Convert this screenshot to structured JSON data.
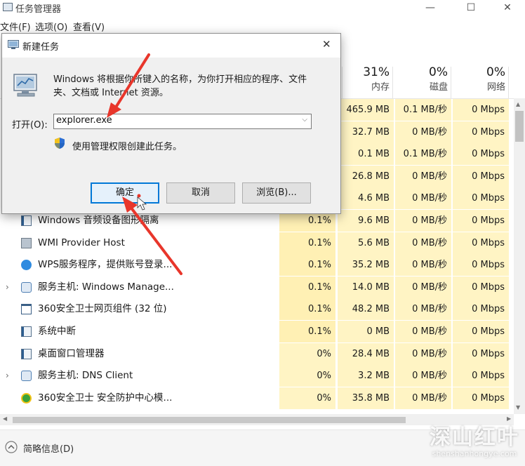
{
  "window": {
    "title": "任务管理器",
    "minimize": "—",
    "maximize": "☐",
    "close": "✕"
  },
  "menu": [
    "文件(F)",
    "选项(O)",
    "查看(V)"
  ],
  "columns": [
    {
      "pct": "31%",
      "name": "内存"
    },
    {
      "pct": "0%",
      "name": "磁盘"
    },
    {
      "pct": "0%",
      "name": "网络"
    }
  ],
  "rows": [
    {
      "name": "",
      "cpu": "",
      "mem": "465.9 MB",
      "disk": "0.1 MB/秒",
      "net": "0 Mbps",
      "expand": false,
      "icon": "none"
    },
    {
      "name": "",
      "cpu": "",
      "mem": "32.7 MB",
      "disk": "0 MB/秒",
      "net": "0 Mbps",
      "expand": false,
      "icon": "none"
    },
    {
      "name": "",
      "cpu": "",
      "mem": "0.1 MB",
      "disk": "0.1 MB/秒",
      "net": "0 Mbps",
      "expand": false,
      "icon": "none"
    },
    {
      "name": "",
      "cpu": "",
      "mem": "26.8 MB",
      "disk": "0 MB/秒",
      "net": "0 Mbps",
      "expand": false,
      "icon": "none"
    },
    {
      "name": "",
      "cpu": "",
      "mem": "4.6 MB",
      "disk": "0 MB/秒",
      "net": "0 Mbps",
      "expand": false,
      "icon": "none"
    },
    {
      "name": "Windows 音频设备图形隔离",
      "cpu": "0.1%",
      "mem": "9.6 MB",
      "disk": "0 MB/秒",
      "net": "0 Mbps",
      "expand": false,
      "icon": "app-window-icon"
    },
    {
      "name": "WMI Provider Host",
      "cpu": "0.1%",
      "mem": "5.6 MB",
      "disk": "0 MB/秒",
      "net": "0 Mbps",
      "expand": false,
      "icon": "wmi-icon"
    },
    {
      "name": "WPS服务程序，提供账号登录...",
      "cpu": "0.1%",
      "mem": "35.2 MB",
      "disk": "0 MB/秒",
      "net": "0 Mbps",
      "expand": false,
      "icon": "wps-cloud-icon"
    },
    {
      "name": "服务主机: Windows Manage...",
      "cpu": "0.1%",
      "mem": "14.0 MB",
      "disk": "0 MB/秒",
      "net": "0 Mbps",
      "expand": true,
      "icon": "service-gear-icon"
    },
    {
      "name": "360安全卫士网页组件 (32 位)",
      "cpu": "0.1%",
      "mem": "48.2 MB",
      "disk": "0 MB/秒",
      "net": "0 Mbps",
      "expand": false,
      "icon": "browser-window-icon"
    },
    {
      "name": "系统中断",
      "cpu": "0.1%",
      "mem": "0 MB",
      "disk": "0 MB/秒",
      "net": "0 Mbps",
      "expand": false,
      "icon": "app-window-icon"
    },
    {
      "name": "桌面窗口管理器",
      "cpu": "0%",
      "mem": "28.4 MB",
      "disk": "0 MB/秒",
      "net": "0 Mbps",
      "expand": false,
      "icon": "app-window-icon"
    },
    {
      "name": "服务主机: DNS Client",
      "cpu": "0%",
      "mem": "3.2 MB",
      "disk": "0 MB/秒",
      "net": "0 Mbps",
      "expand": true,
      "icon": "service-gear-icon"
    },
    {
      "name": "360安全卫士 安全防护中心模...",
      "cpu": "0%",
      "mem": "35.8 MB",
      "disk": "0 MB/秒",
      "net": "0 Mbps",
      "expand": false,
      "icon": "shield-360-icon"
    }
  ],
  "footer": {
    "label": "简略信息(D)"
  },
  "dialog": {
    "title": "新建任务",
    "description": "Windows 将根据你所键入的名称，为你打开相应的程序、文件夹、文档或 Internet 资源。",
    "open_label": "打开(O):",
    "input_value": "explorer.exe",
    "admin_label": "使用管理权限创建此任务。",
    "ok": "确定",
    "cancel": "取消",
    "browse": "浏览(B)..."
  },
  "watermark": {
    "main": "深山红叶",
    "sub": "shenshanhongye.com"
  },
  "colors": {
    "cpu_high": "#fff0b4",
    "cpu_low": "#fff4c4",
    "heat": "#fff4c4",
    "accent": "#0078d7",
    "arrow": "#e8362b"
  }
}
